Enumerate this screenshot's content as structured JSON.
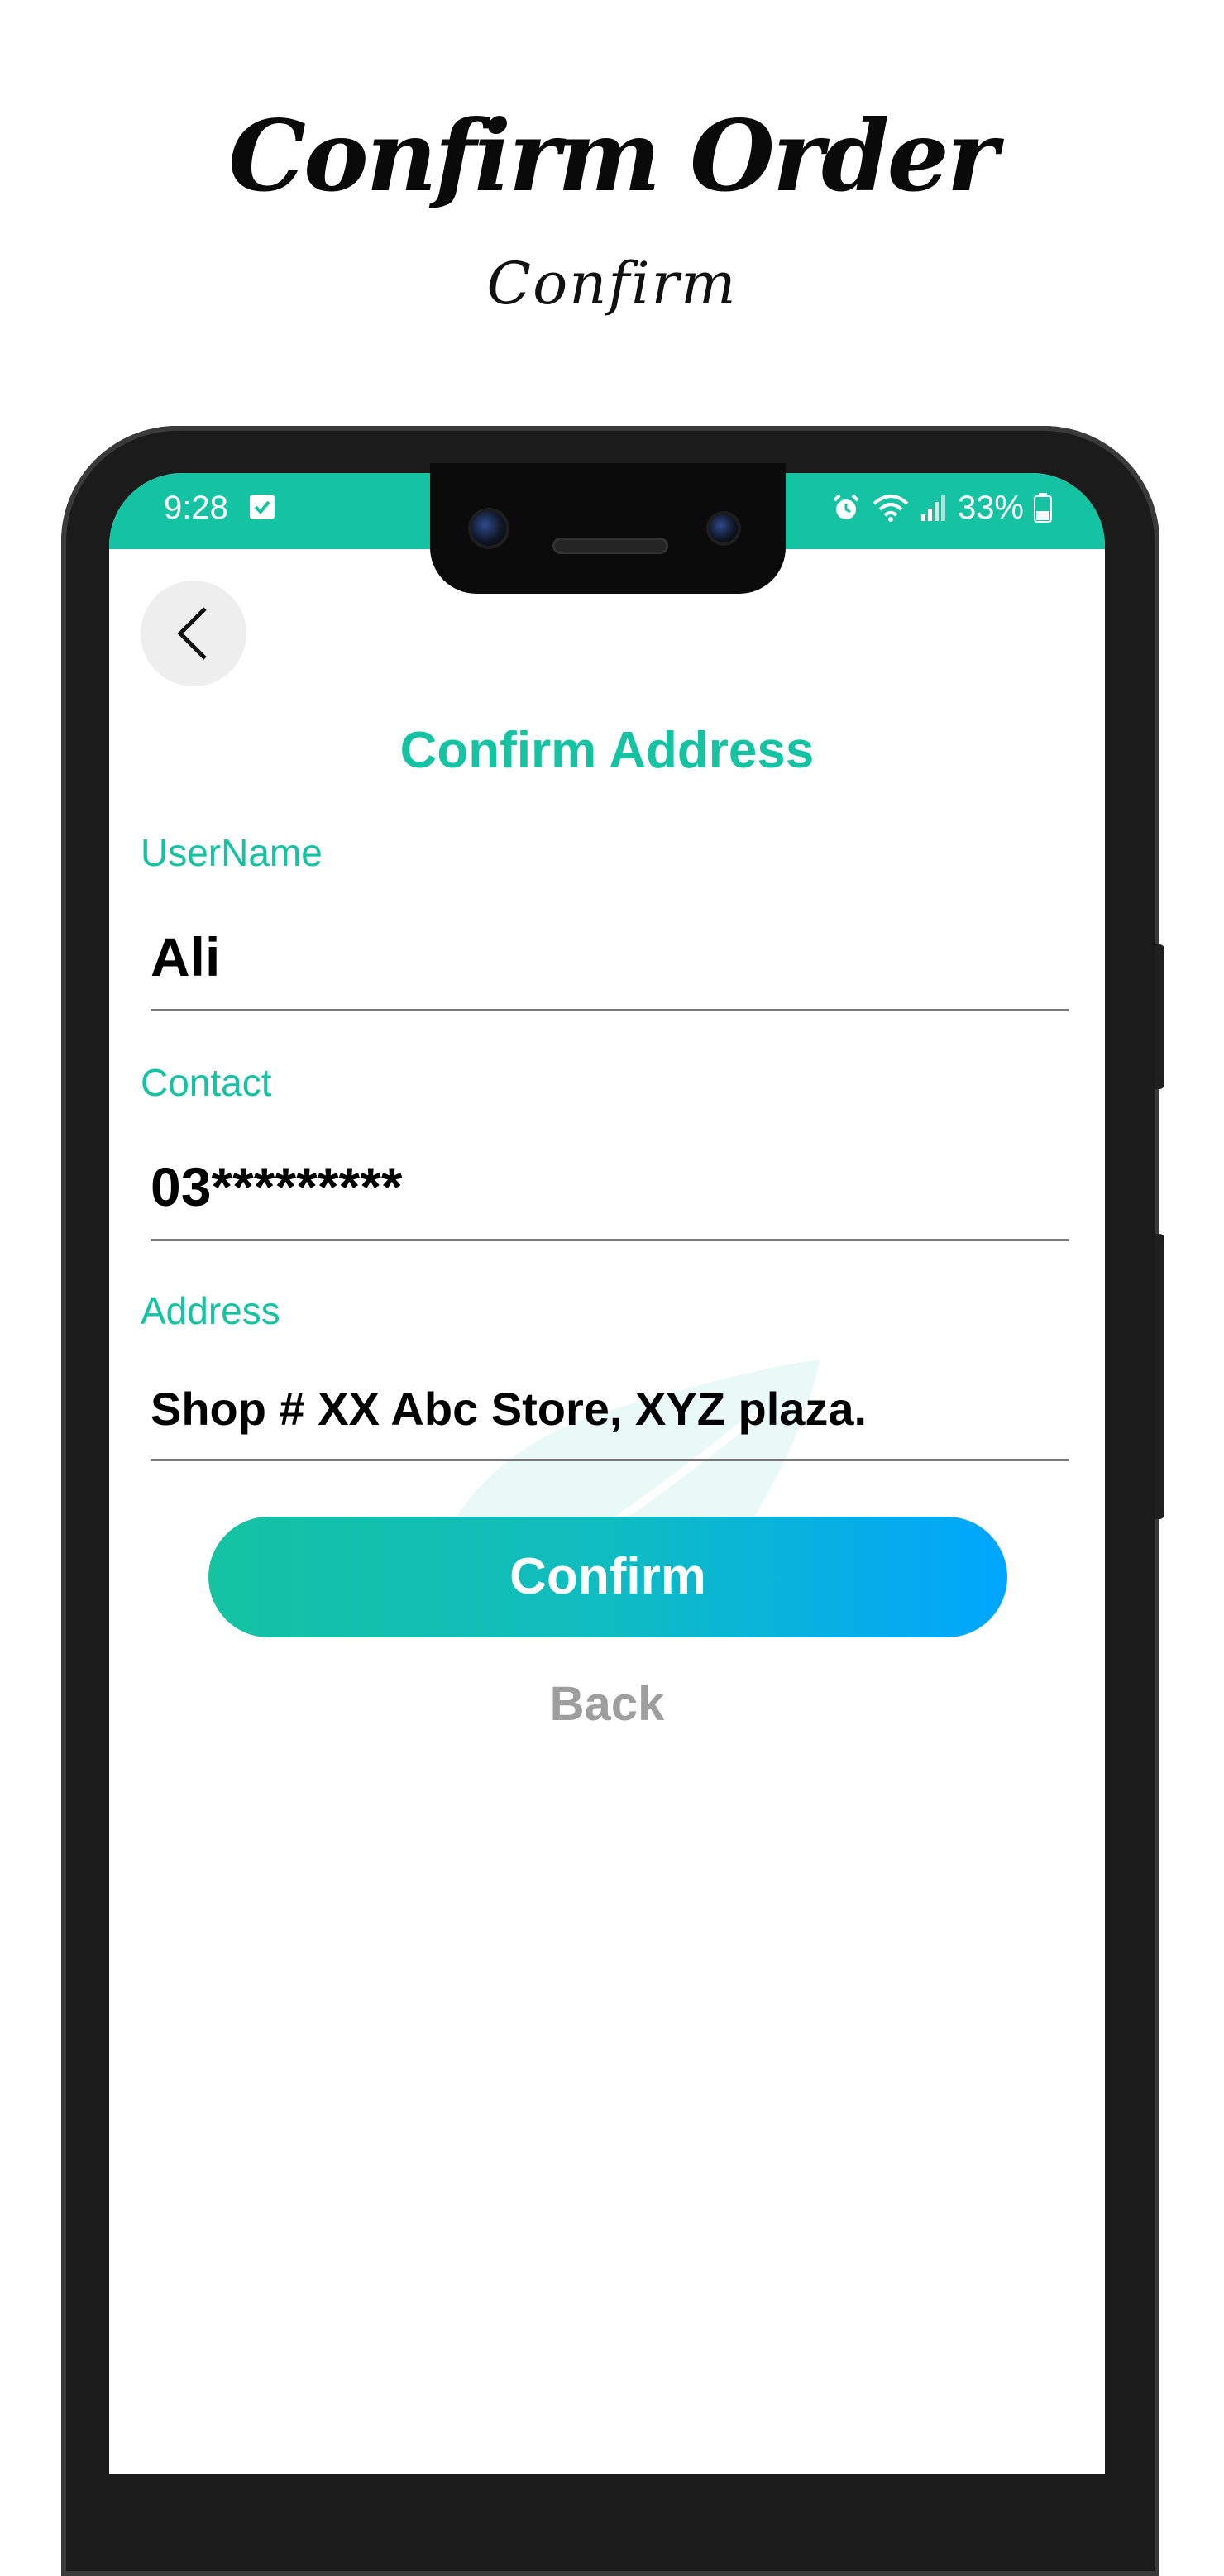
{
  "promo": {
    "title": "Confirm Order",
    "subtitle": "Confirm"
  },
  "status_bar": {
    "time": "9:28",
    "battery": "33%",
    "icons": [
      "check-icon",
      "alarm-icon",
      "wifi-icon",
      "signal-icon",
      "battery-icon"
    ],
    "color": "#15c2a2"
  },
  "screen": {
    "title": "Confirm Address",
    "back_icon": "chevron-left-icon",
    "fields": {
      "username": {
        "label": "UserName",
        "value": "Ali"
      },
      "contact": {
        "label": "Contact",
        "value": "03*********"
      },
      "address": {
        "label": "Address",
        "value": "Shop # XX Abc Store, XYZ plaza."
      }
    },
    "confirm_label": "Confirm",
    "back_label": "Back"
  },
  "colors": {
    "accent": "#15c2a2",
    "gradient_end": "#00a6ff",
    "muted": "#9e9e9e"
  }
}
